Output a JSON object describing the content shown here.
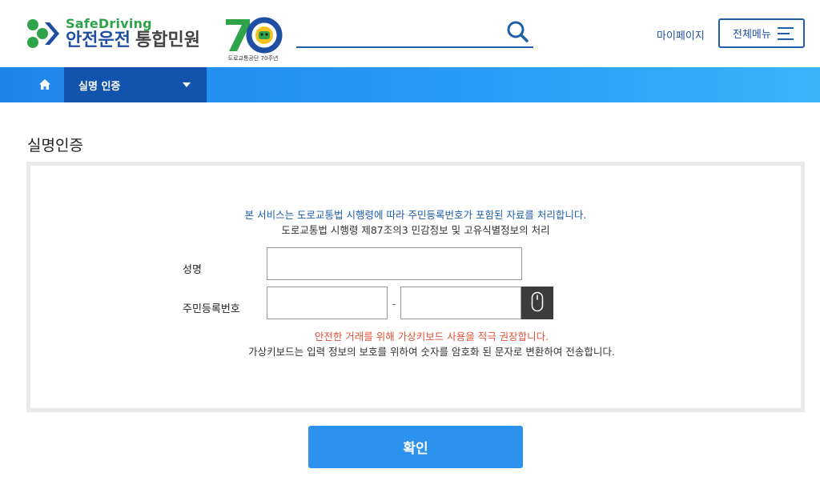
{
  "header": {
    "logo_en": "SafeDriving",
    "logo_ko_main": "안전운전",
    "logo_ko_sub": "통합민원",
    "anniversary_caption": "도로교통공단 70주년",
    "search_placeholder": "",
    "mypage_label": "마이페이지",
    "allmenu_label": "전체메뉴"
  },
  "nav": {
    "home_icon": "home-icon",
    "breadcrumb_label": "실명 인증"
  },
  "main": {
    "title": "실명인증",
    "notice_line1": "본 서비스는 도로교통법 시행령에 따라 주민등록번호가 포함된 자료를 처리합니다.",
    "notice_line2": "도로교통법 시행령 제87조의3 민감정보 및 고유식별정보의 처리",
    "name_label": "성명",
    "rrn_label": "주민등록번호",
    "rrn_separator": "-",
    "warning_line1": "안전한 거래를 위해 가상키보드 사용을 적극 권장합니다.",
    "warning_line2": "가상키보드는 입력 정보의 보호를 위하여 숫자를 암호화 된 문자로 변환하여 전송합니다.",
    "confirm_label": "확인"
  },
  "colors": {
    "brand_blue": "#1f5ea8",
    "nav_dark": "#1254ad",
    "nav_light": "#2a9cf5",
    "warning_red": "#e0533a",
    "logo_green": "#2fa34a",
    "button_blue": "#2c92ee"
  }
}
